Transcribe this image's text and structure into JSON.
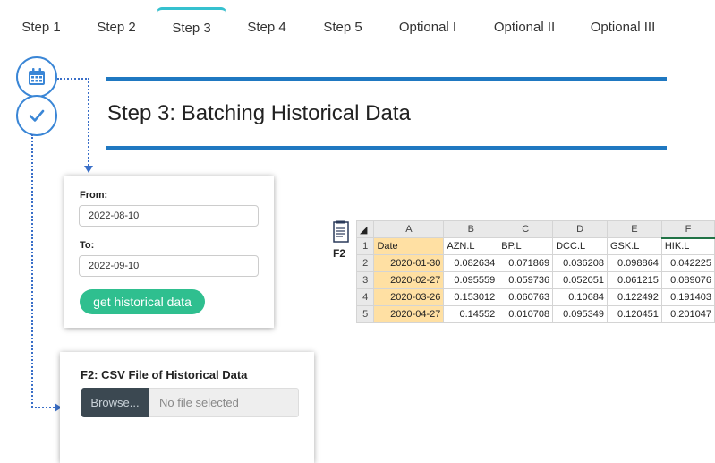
{
  "tabs": [
    {
      "label": "Step 1",
      "active": false
    },
    {
      "label": "Step 2",
      "active": false
    },
    {
      "label": "Step 3",
      "active": true
    },
    {
      "label": "Step 4",
      "active": false
    },
    {
      "label": "Step 5",
      "active": false
    },
    {
      "label": "Optional I",
      "active": false
    },
    {
      "label": "Optional II",
      "active": false
    },
    {
      "label": "Optional III",
      "active": false
    }
  ],
  "icons": {
    "calendar": "calendar-icon",
    "check": "check-icon",
    "document": "document-icon"
  },
  "colors": {
    "accent": "#1f78c1",
    "tab_highlight": "#35c1cf",
    "button_green": "#2fbf8f",
    "connector": "#3a6fc8",
    "date_column": "#ffe0a3"
  },
  "page_title": "Step 3: Batching Historical Data",
  "date_form": {
    "from_label": "From:",
    "from_value": "2022-08-10",
    "to_label": "To:",
    "to_value": "2022-09-10",
    "button_label": "get historical data"
  },
  "csv_upload": {
    "title": "F2: CSV File of Historical Data",
    "browse_label": "Browse...",
    "file_status": "No file selected"
  },
  "spreadsheet": {
    "file_label": "F2",
    "column_letters": [
      "A",
      "B",
      "C",
      "D",
      "E",
      "F"
    ],
    "rows": [
      {
        "row": "1",
        "cells": [
          "Date",
          "AZN.L",
          "BP.L",
          "DCC.L",
          "GSK.L",
          "HIK.L"
        ]
      },
      {
        "row": "2",
        "cells": [
          "2020-01-30",
          "0.082634",
          "0.071869",
          "0.036208",
          "0.098864",
          "0.042225"
        ]
      },
      {
        "row": "3",
        "cells": [
          "2020-02-27",
          "0.095559",
          "0.059736",
          "0.052051",
          "0.061215",
          "0.089076"
        ]
      },
      {
        "row": "4",
        "cells": [
          "2020-03-26",
          "0.153012",
          "0.060763",
          "0.10684",
          "0.122492",
          "0.191403"
        ]
      },
      {
        "row": "5",
        "cells": [
          "2020-04-27",
          "0.14552",
          "0.010708",
          "0.095349",
          "0.120451",
          "0.201047"
        ]
      }
    ]
  }
}
